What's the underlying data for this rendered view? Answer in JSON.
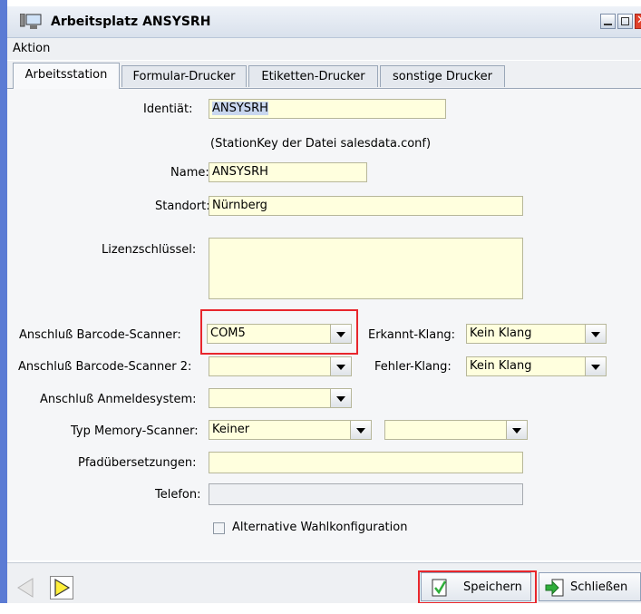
{
  "window": {
    "title": "Arbeitsplatz ANSYSRH"
  },
  "menu": {
    "items": [
      "Aktion"
    ]
  },
  "tabs": [
    "Arbeitsstation",
    "Formular-Drucker",
    "Etiketten-Drucker",
    "sonstige Drucker"
  ],
  "form": {
    "identitaet_label": "Identiät:",
    "identitaet_value": "ANSYSRH",
    "identitaet_hint": "(StationKey der Datei salesdata.conf)",
    "name_label": "Name:",
    "name_value": "ANSYSRH",
    "standort_label": "Standort:",
    "standort_value": "Nürnberg",
    "lizenz_label": "Lizenzschlüssel:",
    "lizenz_value": "",
    "scanner_label": "Anschluß Barcode-Scanner:",
    "scanner_value": "COM5",
    "erkannt_label": "Erkannt-Klang:",
    "erkannt_value": "Kein Klang",
    "scanner2_label": "Anschluß Barcode-Scanner 2:",
    "scanner2_value": "",
    "fehler_label": "Fehler-Klang:",
    "fehler_value": "Kein Klang",
    "anmelde_label": "Anschluß Anmeldesystem:",
    "anmelde_value": "",
    "memory_label": "Typ Memory-Scanner:",
    "memory_value": "Keiner",
    "memory_value2": "",
    "pfad_label": "Pfadübersetzungen:",
    "pfad_value": "",
    "telefon_label": "Telefon:",
    "telefon_value": "",
    "alt_wahl_label": "Alternative Wahlkonfiguration",
    "alt_wahl_checked": false
  },
  "footer": {
    "save_label": "Speichern",
    "close_label": "Schließen"
  },
  "colors": {
    "field_bg": "#ffffde",
    "highlight": "#e8262c",
    "accent": "#5b7bd4"
  }
}
